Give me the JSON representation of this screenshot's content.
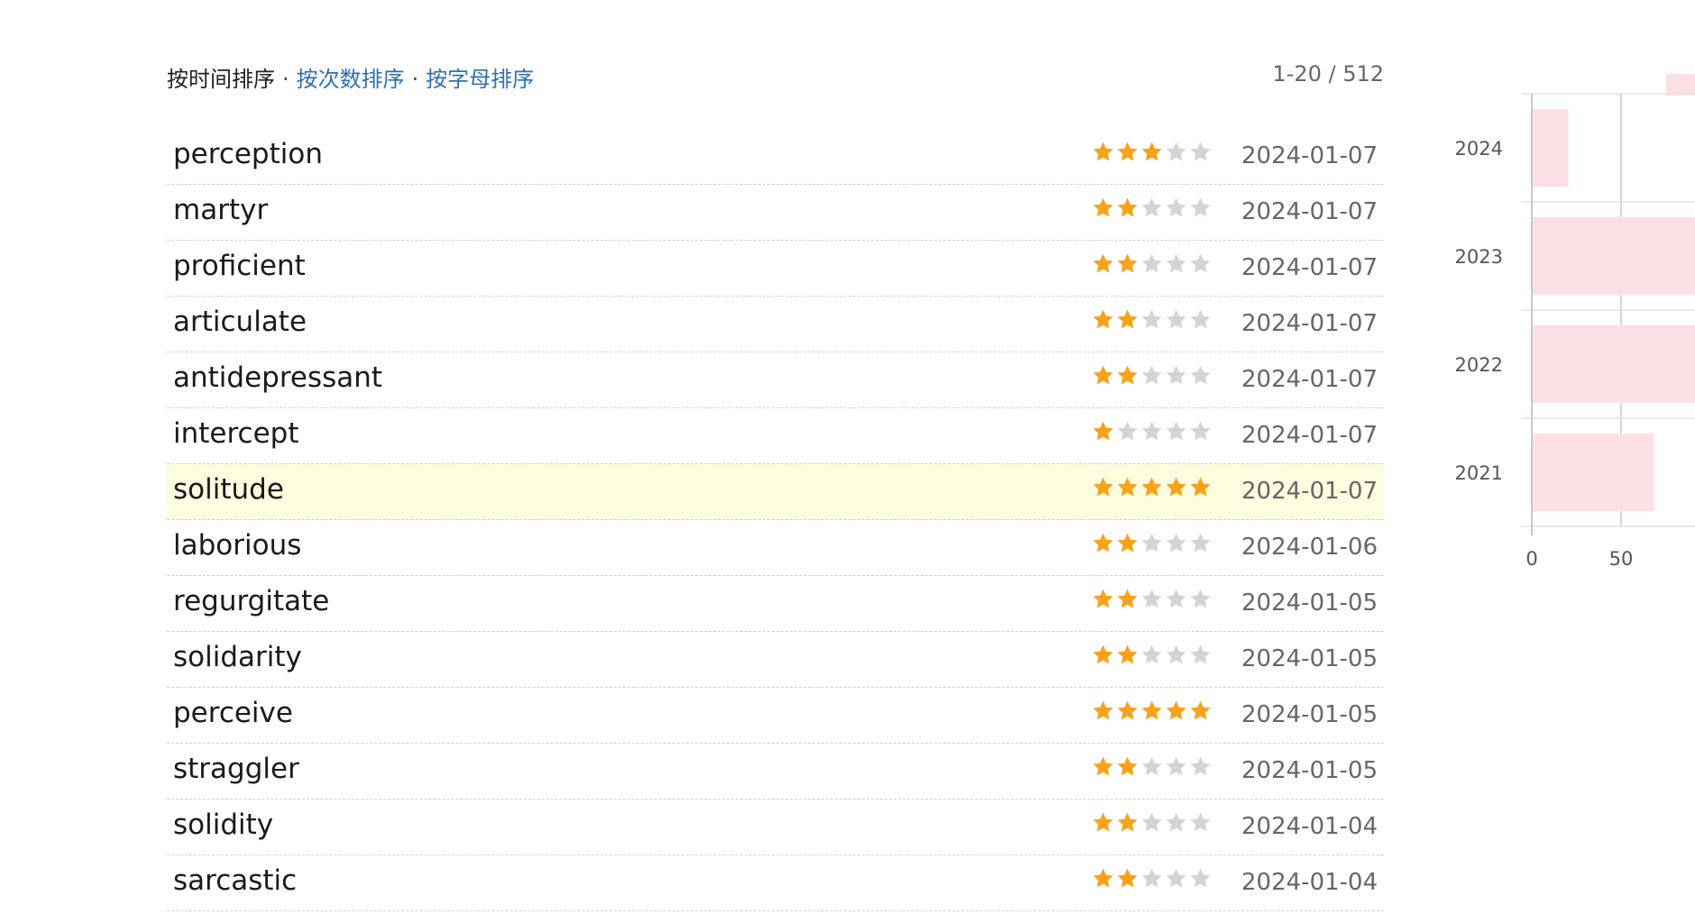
{
  "sort": {
    "by_time": "按时间排序",
    "separator": "·",
    "by_count": "按次数排序",
    "by_alpha": "按字母排序",
    "range": "1-20 / 512"
  },
  "words": [
    {
      "word": "perception",
      "stars": 3,
      "date": "2024-01-07",
      "highlighted": false
    },
    {
      "word": "martyr",
      "stars": 2,
      "date": "2024-01-07",
      "highlighted": false
    },
    {
      "word": "proficient",
      "stars": 2,
      "date": "2024-01-07",
      "highlighted": false
    },
    {
      "word": "articulate",
      "stars": 2,
      "date": "2024-01-07",
      "highlighted": false
    },
    {
      "word": "antidepressant",
      "stars": 2,
      "date": "2024-01-07",
      "highlighted": false
    },
    {
      "word": "intercept",
      "stars": 1,
      "date": "2024-01-07",
      "highlighted": false
    },
    {
      "word": "solitude",
      "stars": 5,
      "date": "2024-01-07",
      "highlighted": true
    },
    {
      "word": "laborious",
      "stars": 2,
      "date": "2024-01-06",
      "highlighted": false
    },
    {
      "word": "regurgitate",
      "stars": 2,
      "date": "2024-01-05",
      "highlighted": false
    },
    {
      "word": "solidarity",
      "stars": 2,
      "date": "2024-01-05",
      "highlighted": false
    },
    {
      "word": "perceive",
      "stars": 5,
      "date": "2024-01-05",
      "highlighted": false
    },
    {
      "word": "straggler",
      "stars": 2,
      "date": "2024-01-05",
      "highlighted": false
    },
    {
      "word": "solidity",
      "stars": 2,
      "date": "2024-01-04",
      "highlighted": false
    },
    {
      "word": "sarcastic",
      "stars": 2,
      "date": "2024-01-04",
      "highlighted": false
    }
  ],
  "star_colors": {
    "filled": "#f7a21b",
    "empty": "#d4d4d4"
  },
  "chart_data": {
    "type": "bar",
    "orientation": "horizontal",
    "categories": [
      "2024",
      "2023",
      "2022",
      "2021"
    ],
    "values": [
      20,
      160,
      160,
      68
    ],
    "xticks": [
      "0",
      "50"
    ],
    "bar_color": "#fde0e6"
  }
}
